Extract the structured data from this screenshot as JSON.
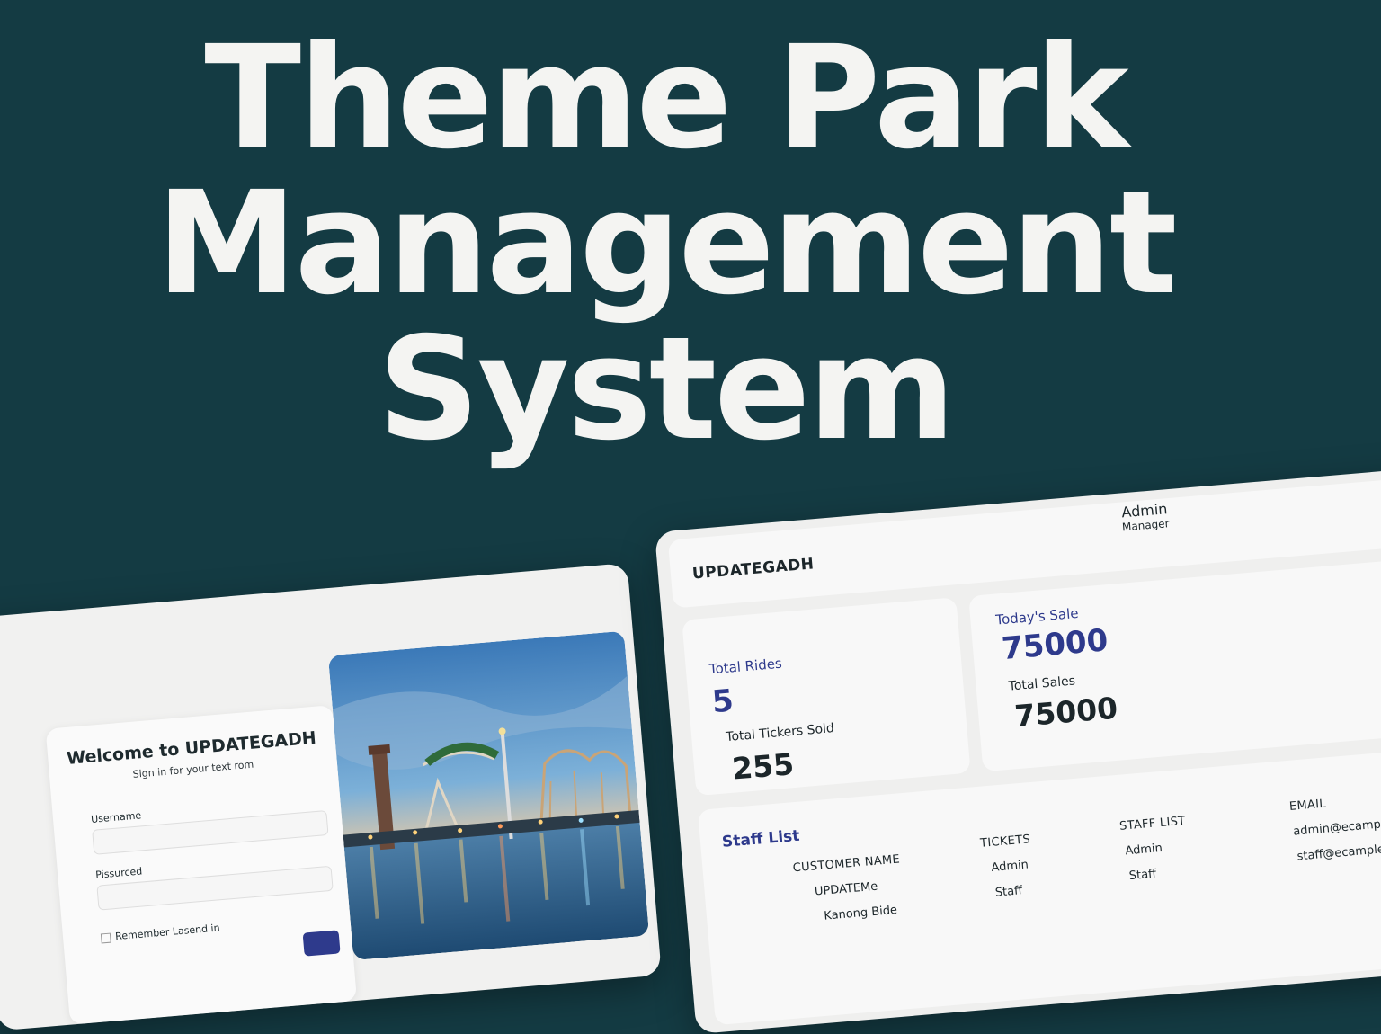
{
  "hero": {
    "line1": "Theme Park",
    "line2": "Management",
    "line3": "System"
  },
  "login": {
    "title": "Welcome to UPDATEGADH",
    "subtitle": "Sign in for your text rom",
    "username_label": "Username",
    "password_label": "Pissurced",
    "remember_label": "Remember Lasend in"
  },
  "dashboard": {
    "brand": "UPDATEGADH",
    "user": {
      "name": "Admin",
      "role": "Manager"
    },
    "stats": {
      "total_rides_label": "Total Rides",
      "total_rides_value": "5",
      "tickets_sold_label": "Total Tickers Sold",
      "tickets_sold_value": "255",
      "todays_sale_label": "Today's Sale",
      "todays_sale_value": "75000",
      "total_sales_label": "Total Sales",
      "total_sales_value": "75000"
    },
    "staff": {
      "title": "Staff List",
      "columns": [
        "CUSTOMER NAME",
        "TICKETS",
        "STAFF LIST",
        "EMAIL"
      ],
      "rows": [
        [
          "UPDATEMe",
          "Admin",
          "Admin",
          "admin@ecample.com"
        ],
        [
          "Kanong Bide",
          "Staff",
          "Staff",
          "staff@ecample.com"
        ]
      ]
    }
  },
  "colors": {
    "background": "#143b43",
    "accent": "#2e3a8c",
    "text_dark": "#1c262a",
    "panel": "#efefee"
  }
}
